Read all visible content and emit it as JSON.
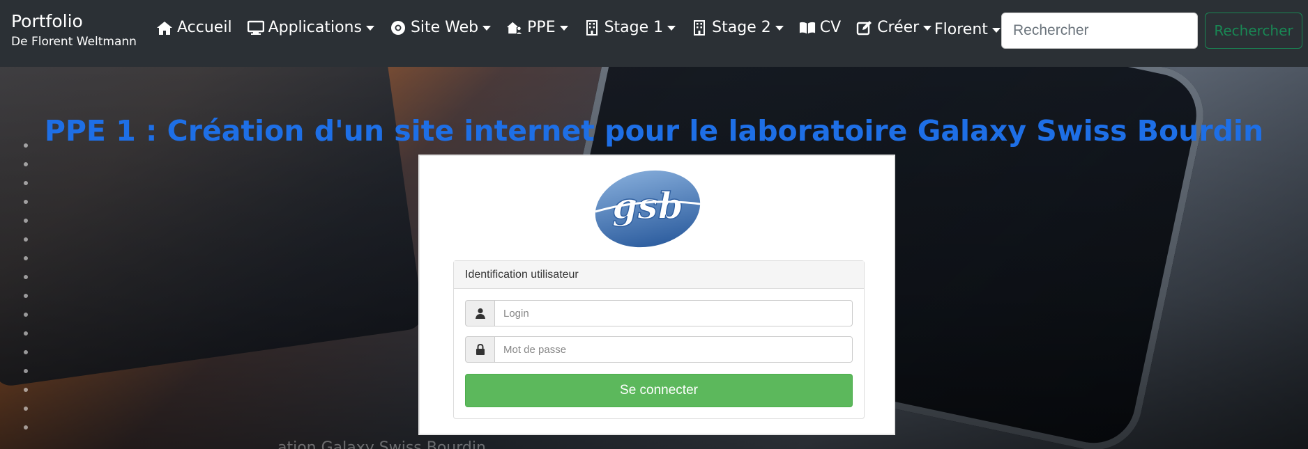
{
  "brand": {
    "title": "Portfolio",
    "subtitle": "De Florent Weltmann"
  },
  "nav": {
    "accueil": "Accueil",
    "applications": "Applications",
    "site_web": "Site Web",
    "ppe": "PPE",
    "stage1": "Stage 1",
    "stage2": "Stage 2",
    "cv": "CV",
    "creer": "Créer"
  },
  "user": {
    "name": "Florent"
  },
  "search": {
    "placeholder": "Rechercher",
    "button": "Rechercher"
  },
  "hero": {
    "title": "PPE 1 : Création d'un site internet pour le laboratoire Galaxy Swiss Bourdin",
    "caption": "... ation Galaxy Swiss Bourdin ..."
  },
  "login_card": {
    "logo_text": "gsb",
    "panel_title": "Identification utilisateur",
    "login_placeholder": "Login",
    "password_placeholder": "Mot de passe",
    "submit": "Se connecter"
  },
  "colors": {
    "navbar": "#2b3035",
    "title_blue": "#1e6fe6",
    "search_green": "#198754",
    "login_green": "#5cb85c"
  }
}
